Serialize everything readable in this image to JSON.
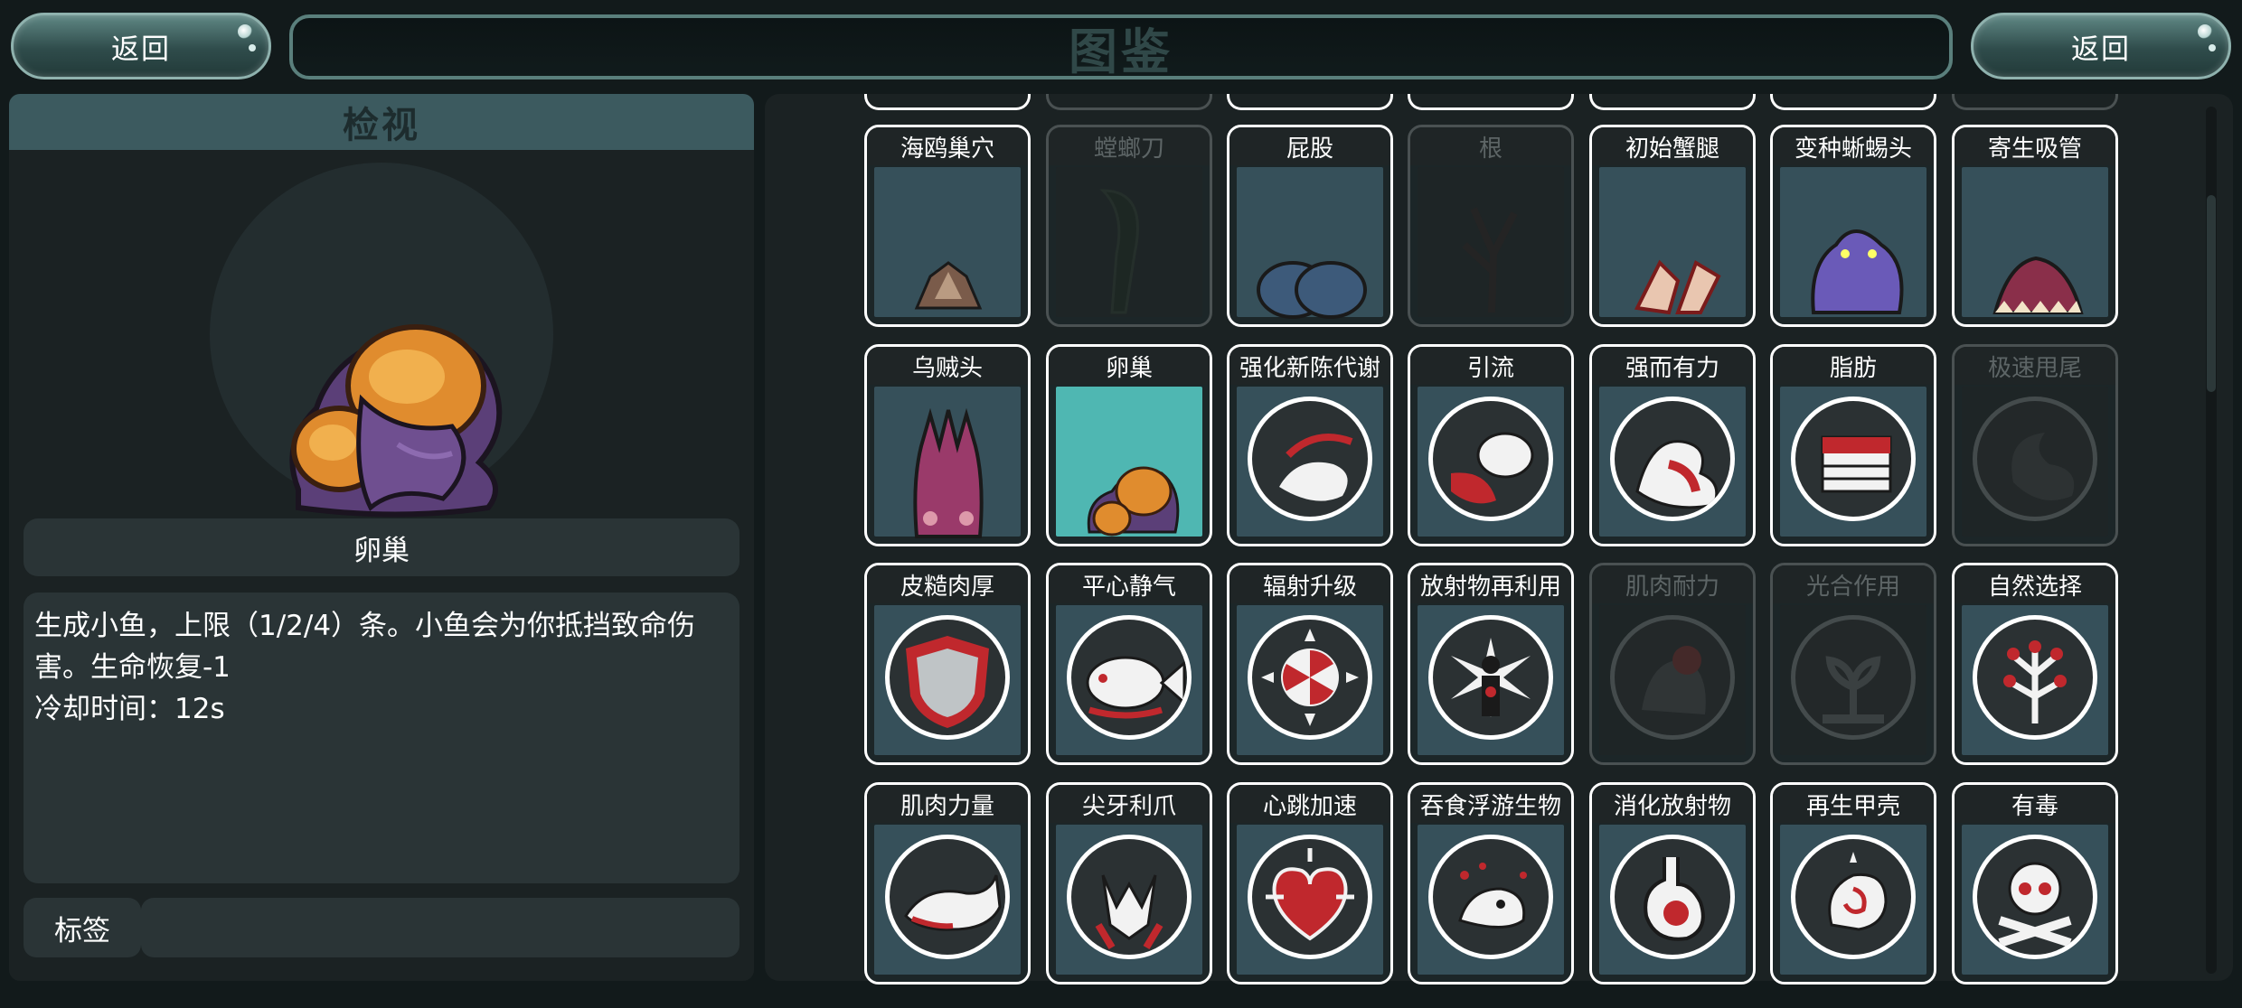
{
  "header": {
    "back_left_label": "返回",
    "title": "图鉴",
    "back_right_label": "返回"
  },
  "inspect": {
    "heading": "检视",
    "item_name": "卵巢",
    "description_lines": [
      "生成小鱼，上限（1/2/4）条。小鱼会为你抵挡致命伤",
      "害。生命恢复-1",
      "冷却时间：12s"
    ],
    "tag_label": "标签",
    "tag_value": ""
  },
  "codex": {
    "rows": [
      [
        {
          "name": "海鸥巢穴",
          "icon": "seagull-nest-icon",
          "locked": false
        },
        {
          "name": "螳螂刀",
          "icon": "mantis-blade-icon",
          "locked": true
        },
        {
          "name": "屁股",
          "icon": "buttocks-icon",
          "locked": false
        },
        {
          "name": "根",
          "icon": "root-icon",
          "locked": true
        },
        {
          "name": "初始蟹腿",
          "icon": "crab-leg-icon",
          "locked": false
        },
        {
          "name": "变种蜥蜴头",
          "icon": "mutant-lizard-head-icon",
          "locked": false
        },
        {
          "name": "寄生吸管",
          "icon": "parasite-sucker-icon",
          "locked": false
        }
      ],
      [
        {
          "name": "乌贼头",
          "icon": "squid-head-icon",
          "locked": false
        },
        {
          "name": "卵巢",
          "icon": "ovary-icon",
          "locked": false,
          "selected": true
        },
        {
          "name": "强化新陈代谢",
          "icon": "metabolism-icon",
          "locked": false
        },
        {
          "name": "引流",
          "icon": "drainage-icon",
          "locked": false
        },
        {
          "name": "强而有力",
          "icon": "strong-arm-icon",
          "locked": false
        },
        {
          "name": "脂肪",
          "icon": "fat-icon",
          "locked": false
        },
        {
          "name": "极速甩尾",
          "icon": "tail-whip-icon",
          "locked": true
        }
      ],
      [
        {
          "name": "皮糙肉厚",
          "icon": "shield-icon",
          "locked": false
        },
        {
          "name": "平心静气",
          "icon": "calm-fish-icon",
          "locked": false
        },
        {
          "name": "辐射升级",
          "icon": "radiation-upgrade-icon",
          "locked": false
        },
        {
          "name": "放射物再利用",
          "icon": "radiation-reuse-icon",
          "locked": false
        },
        {
          "name": "肌肉耐力",
          "icon": "muscle-endurance-icon",
          "locked": true
        },
        {
          "name": "光合作用",
          "icon": "photosynthesis-icon",
          "locked": true
        },
        {
          "name": "自然选择",
          "icon": "natural-selection-icon",
          "locked": false
        }
      ],
      [
        {
          "name": "肌肉力量",
          "icon": "whale-icon",
          "locked": false
        },
        {
          "name": "尖牙利爪",
          "icon": "fangs-claws-icon",
          "locked": false
        },
        {
          "name": "心跳加速",
          "icon": "heartbeat-icon",
          "locked": false
        },
        {
          "name": "吞食浮游生物",
          "icon": "plankton-icon",
          "locked": false
        },
        {
          "name": "消化放射物",
          "icon": "stomach-icon",
          "locked": false
        },
        {
          "name": "再生甲壳",
          "icon": "regen-shell-icon",
          "locked": false
        },
        {
          "name": "有毒",
          "icon": "skull-icon",
          "locked": false
        }
      ]
    ],
    "top_stub_locked": [
      false,
      true,
      false,
      false,
      false,
      false,
      true
    ]
  },
  "colors": {
    "panel": "#1b2223",
    "inspect_header": "#3c5a5f",
    "card_art_bg": "#36505a",
    "selected_art_bg": "#4fb7b2",
    "accent_red": "#c0282d"
  }
}
